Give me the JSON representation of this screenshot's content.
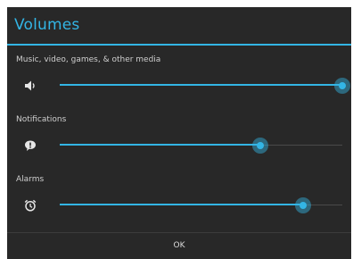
{
  "dialog": {
    "title": "Volumes",
    "accent_color": "#33b5e5",
    "background_color": "#282828"
  },
  "volumes": [
    {
      "label": "Music, video, games, & other media",
      "icon": "speaker-icon",
      "level": 1.0
    },
    {
      "label": "Notifications",
      "icon": "notification-icon",
      "level": 0.71
    },
    {
      "label": "Alarms",
      "icon": "alarm-clock-icon",
      "level": 0.86
    }
  ],
  "buttons": {
    "ok_label": "OK"
  }
}
